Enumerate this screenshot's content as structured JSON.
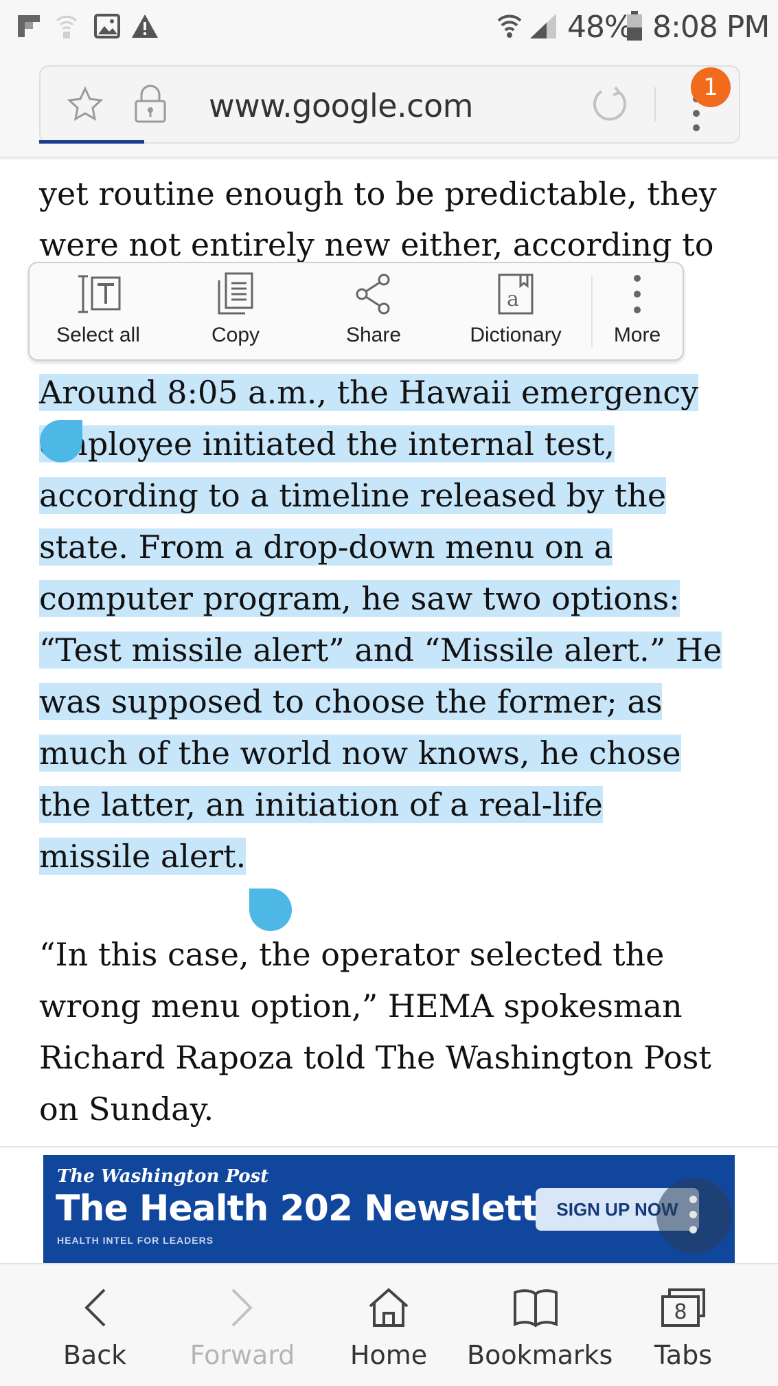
{
  "status_bar": {
    "battery": "48%",
    "time": "8:08 PM",
    "icons": [
      "flipboard-icon",
      "wifi-calling-icon",
      "image-icon",
      "warning-icon",
      "wifi-icon",
      "signal-icon",
      "battery-icon"
    ]
  },
  "browser": {
    "url": "www.google.com",
    "notification_count": "1",
    "icons": [
      "bookmark-star-icon",
      "lock-icon",
      "reload-icon",
      "more-menu-icon"
    ]
  },
  "context_menu": {
    "items": [
      {
        "label": "Select all",
        "icon": "select-all-icon"
      },
      {
        "label": "Copy",
        "icon": "copy-icon"
      },
      {
        "label": "Share",
        "icon": "share-icon"
      },
      {
        "label": "Dictionary",
        "icon": "dictionary-icon"
      },
      {
        "label": "More",
        "icon": "more-vertical-icon"
      }
    ]
  },
  "article": {
    "lines_before": [
      "yet routine enough to be predictable, they",
      "were not entirely new either, according to"
    ],
    "selected_lines": [
      "Around 8:05 a.m., the Hawaii emergency",
      "employee initiated the internal test,",
      "according to a timeline released by the",
      "state. From a drop-down menu on a",
      "computer program, he saw two options:",
      "“Test missile alert” and “Missile alert.” He",
      "was supposed to choose the former; as",
      "much of the world now knows, he chose",
      "the latter, an initiation of a real-life",
      "missile alert."
    ],
    "lines_after": [
      "“In this case, the operator selected the",
      "wrong menu option,” HEMA spokesman",
      "Richard Rapoza told The Washington Post",
      "on Sunday."
    ]
  },
  "ad": {
    "brand": "The Washington Post",
    "title": "The Health 202 Newsletter",
    "subtitle": "HEALTH INTEL FOR LEADERS",
    "cta": "SIGN UP NOW",
    "background": "#10479c"
  },
  "bottom_nav": {
    "items": [
      {
        "label": "Back",
        "icon": "back-icon",
        "enabled": true
      },
      {
        "label": "Forward",
        "icon": "forward-icon",
        "enabled": false
      },
      {
        "label": "Home",
        "icon": "home-icon",
        "enabled": true
      },
      {
        "label": "Bookmarks",
        "icon": "bookmarks-icon",
        "enabled": true
      },
      {
        "label": "Tabs",
        "icon": "tabs-icon",
        "enabled": true,
        "count": "8"
      }
    ]
  },
  "colors": {
    "selection": "#c8e6fa",
    "handle": "#4db8e5",
    "badge": "#f26a1b"
  }
}
